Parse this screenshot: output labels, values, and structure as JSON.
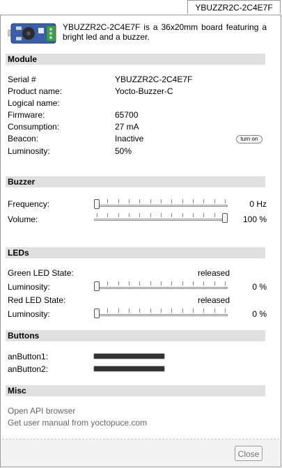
{
  "tab": {
    "label": "YBUZZR2C-2C4E7F"
  },
  "header": {
    "description": "YBUZZR2C-2C4E7F is a 36x20mm board featuring a bright led and a buzzer."
  },
  "module": {
    "title": "Module",
    "serial_label": "Serial #",
    "serial_value": "YBUZZR2C-2C4E7F",
    "product_label": "Product name:",
    "product_value": "Yocto-Buzzer-C",
    "logical_label": "Logical name:",
    "logical_value": "",
    "firmware_label": "Firmware:",
    "firmware_value": "65700",
    "consumption_label": "Consumption:",
    "consumption_value": "27 mA",
    "beacon_label": "Beacon:",
    "beacon_value": "Inactive",
    "beacon_button": "turn on",
    "luminosity_label": "Luminosity:",
    "luminosity_value": "50%"
  },
  "buzzer": {
    "title": "Buzzer",
    "frequency_label": "Frequency:",
    "frequency_value": "0 Hz",
    "frequency_level": 0,
    "volume_label": "Volume:",
    "volume_value": "100 %",
    "volume_level": 1
  },
  "leds": {
    "title": "LEDs",
    "green_state_label": "Green LED State:",
    "green_state_value": "released",
    "green_lum_label": "Luminosity:",
    "green_lum_value": "0 %",
    "green_lum_level": 0,
    "red_state_label": "Red LED State:",
    "red_state_value": "released",
    "red_lum_label": "Luminosity:",
    "red_lum_value": "0 %",
    "red_lum_level": 0
  },
  "buttons": {
    "title": "Buttons",
    "button1_label": "anButton1:",
    "button1_level": 1,
    "button2_label": "anButton2:",
    "button2_level": 1
  },
  "misc": {
    "title": "Misc",
    "api_link": "Open API browser",
    "manual_link": "Get user manual from yoctopuce.com"
  },
  "footer": {
    "close_label": "Close"
  }
}
